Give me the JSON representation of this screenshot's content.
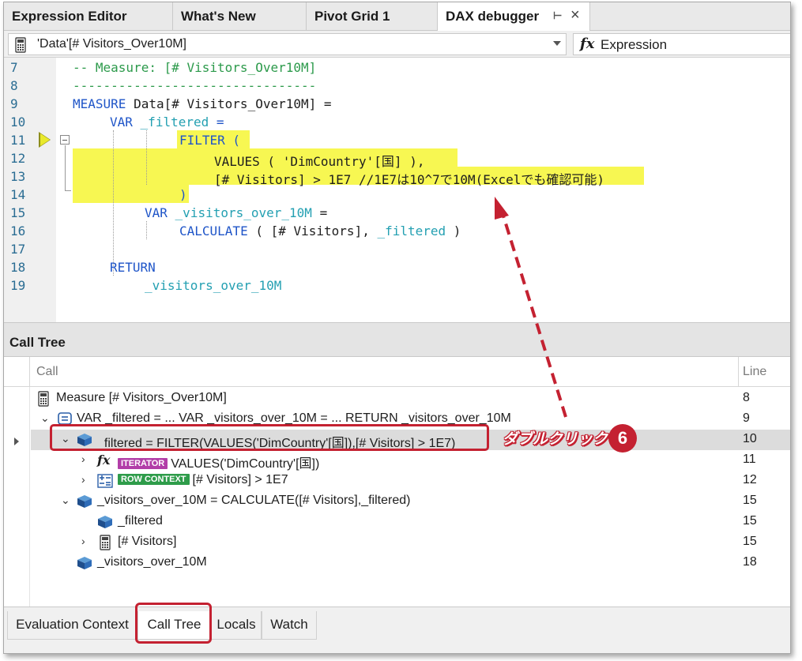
{
  "tabs": [
    {
      "label": "Expression Editor"
    },
    {
      "label": "What's New"
    },
    {
      "label": "Pivot Grid 1"
    },
    {
      "label": "DAX debugger",
      "active": true
    }
  ],
  "selector": {
    "measure": "'Data'[# Visitors_Over10M]",
    "expression_label": "Expression"
  },
  "editor": {
    "lines": [
      {
        "num": "7",
        "text": "-- Measure: [# Visitors_Over10M]"
      },
      {
        "num": "8",
        "text": "--------------------------------"
      },
      {
        "num": "9",
        "kw": "MEASURE",
        "text": " Data[# Visitors_Over10M] ="
      },
      {
        "num": "10",
        "kw": "VAR",
        "var": "_filtered",
        "text": " ="
      },
      {
        "num": "11",
        "kw": "FILTER",
        "text": " ("
      },
      {
        "num": "12",
        "text": "VALUES ( 'DimCountry'[国] ),"
      },
      {
        "num": "13",
        "text": "[# Visitors] > 1E7 //1E7は10^7で10M(Excelでも確認可能)"
      },
      {
        "num": "14",
        "text": ")"
      },
      {
        "num": "15",
        "kw": "VAR",
        "var": "_visitors_over_10M",
        "text": " ="
      },
      {
        "num": "16",
        "kw": "CALCULATE",
        "text": " ( [# Visitors], ",
        "var": "_filtered",
        "tail": " )"
      },
      {
        "num": "17",
        "text": ""
      },
      {
        "num": "18",
        "kw": "RETURN",
        "text": ""
      },
      {
        "num": "19",
        "var": "_visitors_over_10M",
        "text": ""
      }
    ]
  },
  "call_tree": {
    "title": "Call Tree",
    "columns": {
      "call": "Call",
      "line": "Line"
    },
    "rows": [
      {
        "label": "Measure [# Visitors_Over10M]",
        "line": "8"
      },
      {
        "label": "VAR _filtered = ... VAR _visitors_over_10M = ... RETURN _visitors_over_10M",
        "line": "9"
      },
      {
        "label": "_filtered = FILTER(VALUES('DimCountry'[国]),[# Visitors] > 1E7)",
        "line": "10",
        "selected": true
      },
      {
        "badge": "ITERATOR",
        "label": "VALUES('DimCountry'[国])",
        "line": "11"
      },
      {
        "badge": "ROW CONTEXT",
        "label": "[# Visitors] > 1E7",
        "line": "12"
      },
      {
        "label": "_visitors_over_10M = CALCULATE([# Visitors],_filtered)",
        "line": "15"
      },
      {
        "label": "_filtered",
        "line": "15"
      },
      {
        "label": "[# Visitors]",
        "line": "15"
      },
      {
        "label": "_visitors_over_10M",
        "line": "18"
      }
    ]
  },
  "annotation": {
    "label": "ダブルクリック",
    "step": "6",
    "color": "#c42131"
  },
  "bottom_tabs": [
    {
      "label": "Evaluation Context"
    },
    {
      "label": "Call Tree",
      "active": true
    },
    {
      "label": "Locals"
    },
    {
      "label": "Watch"
    }
  ],
  "colors": {
    "keyword": "#1f55c8",
    "comment": "#2c9a4b",
    "variable": "#24a0b2",
    "highlight": "#f7f752",
    "line_number": "#2b6d93"
  }
}
